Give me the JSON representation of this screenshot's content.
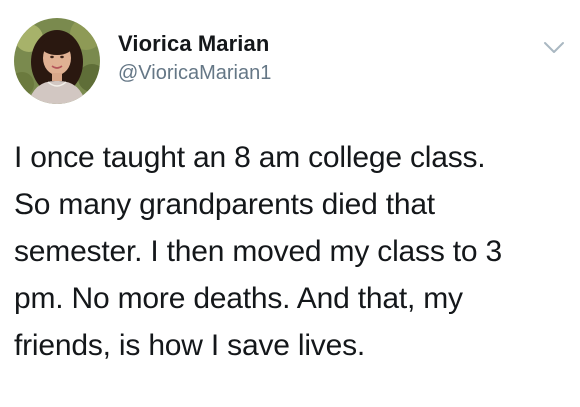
{
  "tweet": {
    "author": {
      "display_name": "Viorica Marian",
      "handle": "@VioricaMarian1",
      "avatar_icon": "profile-photo-avatar"
    },
    "menu_icon": "chevron-down-icon",
    "text_lines": [
      "I once taught an 8 am college class.",
      "So many grandparents died that",
      "semester. I then moved my class to 3",
      "pm. No more deaths. And that, my",
      "friends, is how I save lives."
    ]
  },
  "colors": {
    "name_text": "#14171a",
    "handle_text": "#657786",
    "body_text": "#14171a",
    "chevron": "#aab8c2",
    "background": "#ffffff"
  }
}
